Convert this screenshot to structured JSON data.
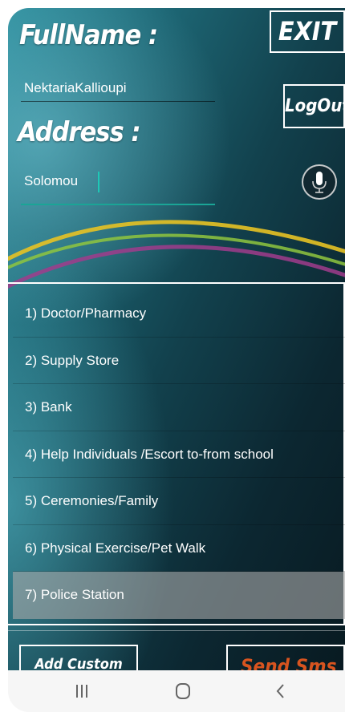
{
  "form": {
    "fullname_label": "FullName :",
    "fullname_value": "NektariaKallioupi",
    "address_label": "Address :",
    "address_value": "Solomou"
  },
  "buttons": {
    "exit": "EXIT",
    "logout": "LogOut",
    "add_custom": "Add Custom",
    "send": "Send Sms"
  },
  "reasons": [
    "1) Doctor/Pharmacy",
    "2) Supply Store",
    "3) Bank",
    "4) Help Individuals /Escort to-from school",
    "5) Ceremonies/Family",
    "6) Physical Exercise/Pet Walk",
    "7) Police Station"
  ],
  "selected_reason": "7) Police Station",
  "icons": {
    "mic": "microphone-icon",
    "recent": "recent-apps-icon",
    "home": "home-icon",
    "back": "back-icon"
  },
  "colors": {
    "accent": "#1aa596",
    "send_text": "#d8541f",
    "arc_yellow": "#e7c224",
    "arc_green": "#8fc63e",
    "arc_purple": "#a03c8c"
  }
}
